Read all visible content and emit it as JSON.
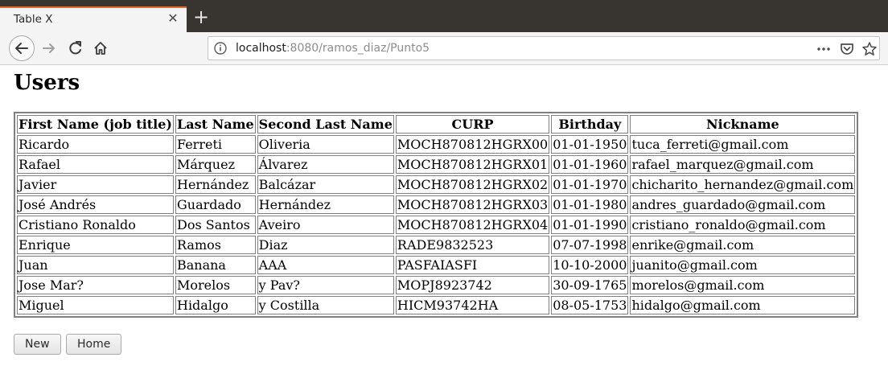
{
  "browser": {
    "tab_title": "Table X",
    "tab_close_icon": "close-icon",
    "new_tab_icon": "plus-icon",
    "url_host": "localhost",
    "url_path": ":8080/ramos_diaz/Punto5",
    "icons": [
      "back-arrow-icon",
      "forward-arrow-icon",
      "reload-icon",
      "home-icon",
      "info-icon",
      "more-dots-icon",
      "pocket-icon",
      "star-icon"
    ]
  },
  "page": {
    "title": "Users",
    "table": {
      "headers": [
        "First Name (job title)",
        "Last Name",
        "Second Last Name",
        "CURP",
        "Birthday",
        "Nickname"
      ],
      "rows": [
        [
          "Ricardo",
          "Ferreti",
          "Oliveria",
          "MOCH870812HGRX00",
          "01-01-1950",
          "tuca_ferreti@gmail.com"
        ],
        [
          "Rafael",
          "Márquez",
          "Álvarez",
          "MOCH870812HGRX01",
          "01-01-1960",
          "rafael_marquez@gmail.com"
        ],
        [
          "Javier",
          "Hernández",
          "Balcázar",
          "MOCH870812HGRX02",
          "01-01-1970",
          "chicharito_hernandez@gmail.com"
        ],
        [
          "José Andrés",
          "Guardado",
          "Hernández",
          "MOCH870812HGRX03",
          "01-01-1980",
          "andres_guardado@gmail.com"
        ],
        [
          "Cristiano Ronaldo",
          "Dos Santos",
          "Aveiro",
          "MOCH870812HGRX04",
          "01-01-1990",
          "cristiano_ronaldo@gmail.com"
        ],
        [
          "Enrique",
          "Ramos",
          "Diaz",
          "RADE9832523",
          "07-07-1998",
          "enrike@gmail.com"
        ],
        [
          "Juan",
          "Banana",
          "AAA",
          "PASFAIASFI",
          "10-10-2000",
          "juanito@gmail.com"
        ],
        [
          "Jose Mar?",
          "Morelos",
          "y Pav?",
          "MOPJ8923742",
          "30-09-1765",
          "morelos@gmail.com"
        ],
        [
          "Miguel",
          "Hidalgo",
          "y Costilla",
          "HICM93742HA",
          "08-05-1753",
          "hidalgo@gmail.com"
        ]
      ]
    },
    "buttons": {
      "new_label": "New",
      "home_label": "Home"
    }
  }
}
